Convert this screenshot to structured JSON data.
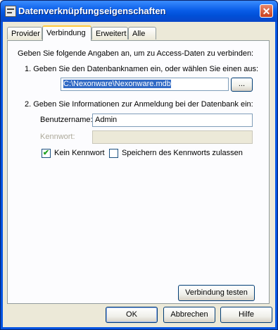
{
  "window": {
    "title": "Datenverknüpfungseigenschaften",
    "close_glyph": "✕"
  },
  "tabs": [
    {
      "label": "Provider",
      "active": false
    },
    {
      "label": "Verbindung",
      "active": true
    },
    {
      "label": "Erweitert",
      "active": false
    },
    {
      "label": "Alle",
      "active": false
    }
  ],
  "connection": {
    "intro": "Geben Sie folgende Angaben an, um zu Access-Daten zu verbinden:",
    "step1_label": "1. Geben Sie den Datenbanknamen ein, oder wählen Sie einen aus:",
    "database_value": "C:\\Nexonware\\Nexonware.mdb",
    "browse_label": "...",
    "step2_label": "2. Geben Sie Informationen zur Anmeldung bei der Datenbank ein:",
    "username_label": "Benutzername:",
    "username_value": "Admin",
    "password_label": "Kennwort:",
    "password_value": "",
    "no_password_label": "Kein Kennwort",
    "no_password_checked": true,
    "save_password_label": "Speichern des Kennworts zulassen",
    "save_password_checked": false,
    "test_button_label": "Verbindung testen"
  },
  "footer": {
    "ok_label": "OK",
    "cancel_label": "Abbrechen",
    "help_label": "Hilfe"
  },
  "icons": {
    "title_icon": "data-link-icon",
    "check_glyph": "✔"
  }
}
